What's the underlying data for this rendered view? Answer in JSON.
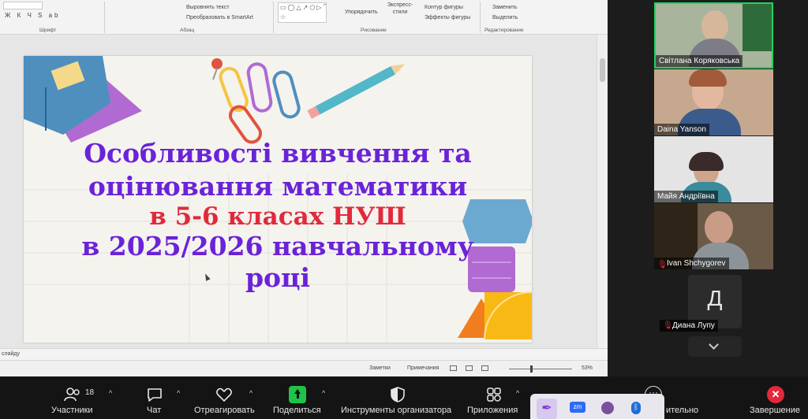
{
  "ribbon": {
    "font_group": "Шрифт",
    "paragraph_group": "Абзац",
    "drawing_group": "Рисование",
    "editing_group": "Редактирование",
    "align_text": "Выровнять текст",
    "smartart": "Преобразовать в SmartArt",
    "arrange": "Упорядочить",
    "express_styles": "Экспресс-стили",
    "shape_outline": "Контур фигуры",
    "shape_effects": "Эффекты фигуры",
    "replace": "Заменить",
    "select": "Выделить",
    "font_buttons": "Ж К Ч S ab"
  },
  "slide": {
    "line1": "Особливості вивчення та",
    "line2": "оцінювання математики",
    "line3": "в 5-6 класах НУШ",
    "line4": "в 2025/2026 навчальному",
    "line5": "році"
  },
  "notes_hint": "слайду",
  "status": {
    "notes": "Заметки",
    "comments": "Примечания",
    "zoom": "53%"
  },
  "participants": [
    {
      "name": "Світлана Коряковська",
      "active": true
    },
    {
      "name": "Daina Yanson"
    },
    {
      "name": "Майя Андріївна"
    },
    {
      "name": "Ivan Shchygorev",
      "muted": true
    },
    {
      "name": "Диана Лупу",
      "muted": true,
      "initial": "Д"
    }
  ],
  "toolbar": {
    "participants_label": "Участники",
    "participants_count": "18",
    "chat_label": "Чат",
    "react_label": "Отреагировать",
    "share_label": "Поделиться",
    "host_tools_label": "Инструменты организатора",
    "apps_label": "Приложения",
    "more_label": "ительно",
    "end_label": "Завершение",
    "apps_tray": [
      "zm"
    ]
  },
  "colors": {
    "title_purple": "#6a23d8",
    "title_red": "#e02a3c",
    "share_green": "#1fc24a",
    "end_red": "#e5283a",
    "active_border": "#23d160"
  }
}
